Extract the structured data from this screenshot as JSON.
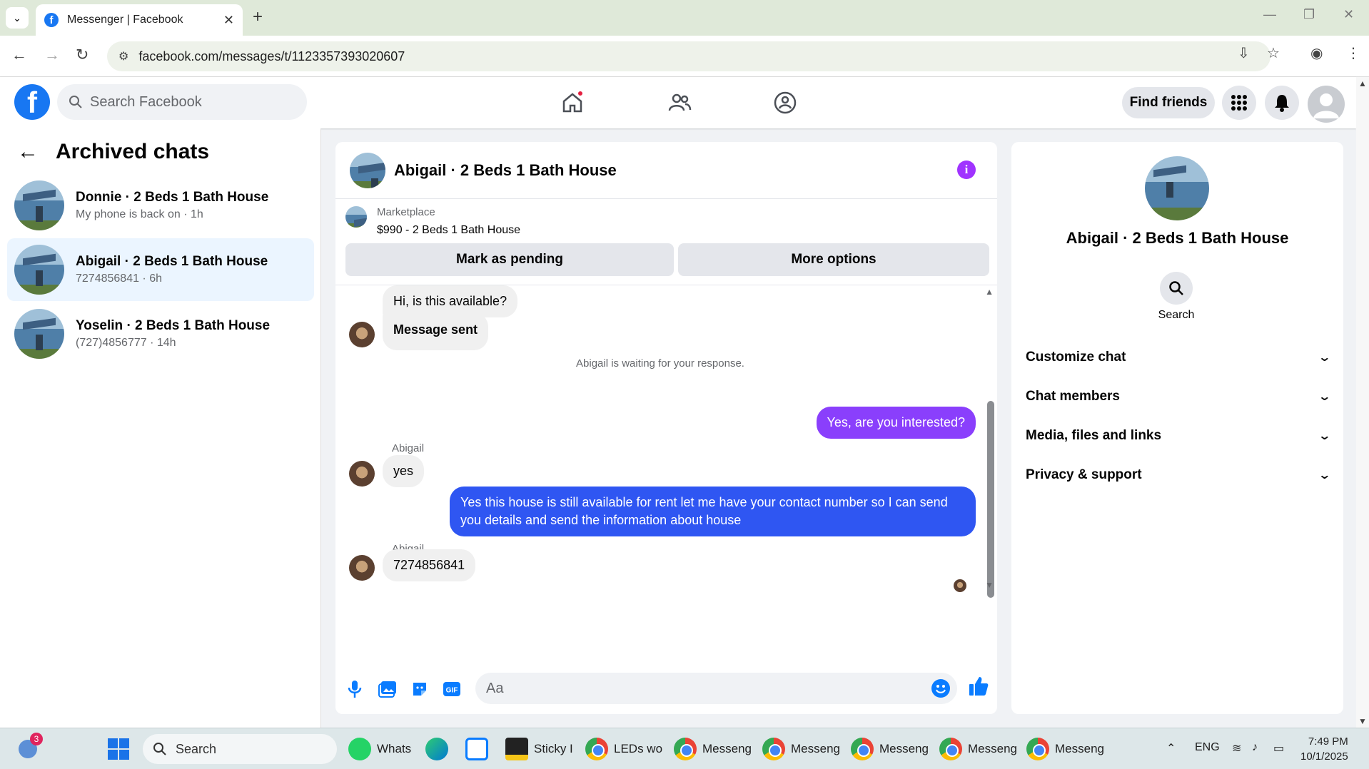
{
  "browser": {
    "tab_title": "Messenger | Facebook",
    "url": "facebook.com/messages/t/1123357393020607"
  },
  "header": {
    "search_placeholder": "Search Facebook",
    "find_friends": "Find friends"
  },
  "left": {
    "title": "Archived chats",
    "chats": [
      {
        "name": "Donnie · 2 Beds 1 Bath House",
        "sub": "My phone is back on · 1h"
      },
      {
        "name": "Abigail · 2 Beds 1 Bath House",
        "sub": "7274856841 · 6h"
      },
      {
        "name": "Yoselin · 2 Beds 1 Bath House",
        "sub": "(727)4856777 · 14h"
      }
    ]
  },
  "conversation": {
    "title": "Abigail · 2 Beds 1 Bath House",
    "marketplace_label": "Marketplace",
    "listing": "$990 - 2 Beds 1 Bath House",
    "mark_pending": "Mark as pending",
    "more_options": "More options",
    "messages": {
      "m1": "Hi, is this available?",
      "m2": "Message sent",
      "waiting": "Abigail is waiting for your response.",
      "m3": "Yes, are you interested?",
      "sender1": "Abigail",
      "m4": "yes",
      "m5": "Yes this house is still available for rent let me have your contact number so I can send you details and send the information about house",
      "sender2": "Abigail",
      "m6": "7274856841"
    },
    "composer_placeholder": "Aa"
  },
  "right": {
    "name": "Abigail · 2 Beds 1 Bath House",
    "search_label": "Search",
    "sections": [
      "Customize chat",
      "Chat members",
      "Media, files and links",
      "Privacy & support"
    ]
  },
  "taskbar": {
    "search": "Search",
    "items": [
      "Whats",
      "Sticky I",
      "LEDs wo",
      "Messeng",
      "Messeng",
      "Messeng",
      "Messeng",
      "Messeng"
    ],
    "notif_count": "3",
    "lang": "ENG",
    "time": "7:49 PM",
    "date": "10/1/2025"
  }
}
